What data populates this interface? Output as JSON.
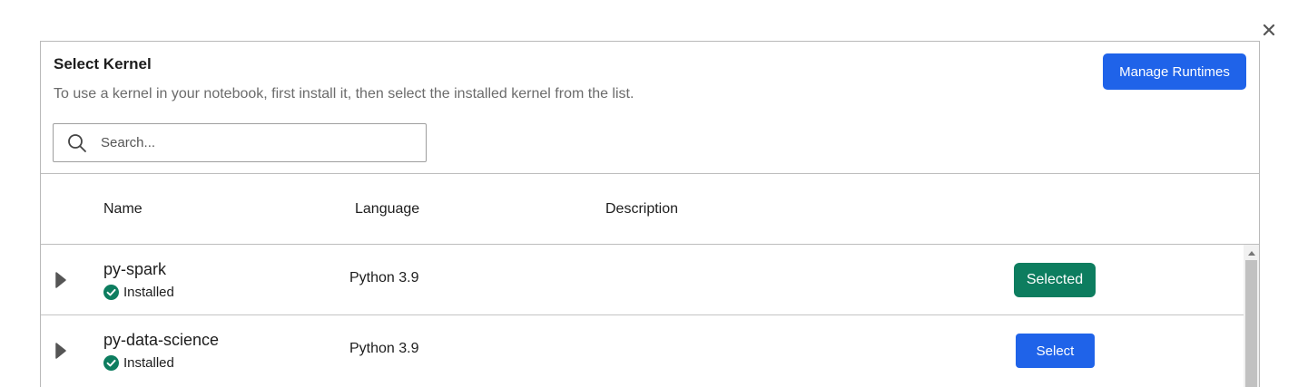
{
  "dialog": {
    "title": "Select Kernel",
    "subtitle": "To use a kernel in your notebook, first install it, then select the installed kernel from the list.",
    "manage_button_label": "Manage Runtimes",
    "close_icon": "close-icon"
  },
  "search": {
    "placeholder": "Search...",
    "value": "",
    "icon": "search-icon"
  },
  "table": {
    "columns": [
      "Name",
      "Language",
      "Description"
    ],
    "rows": [
      {
        "name": "py-spark",
        "status": "Installed",
        "language": "Python 3.9",
        "description": "",
        "action_label": "Selected",
        "selected": true
      },
      {
        "name": "py-data-science",
        "status": "Installed",
        "language": "Python 3.9",
        "description": "",
        "action_label": "Select",
        "selected": false
      }
    ]
  },
  "colors": {
    "primary_button": "#1f63e9",
    "selected_button": "#0d7d5f",
    "installed_check": "#0d7d5f"
  }
}
